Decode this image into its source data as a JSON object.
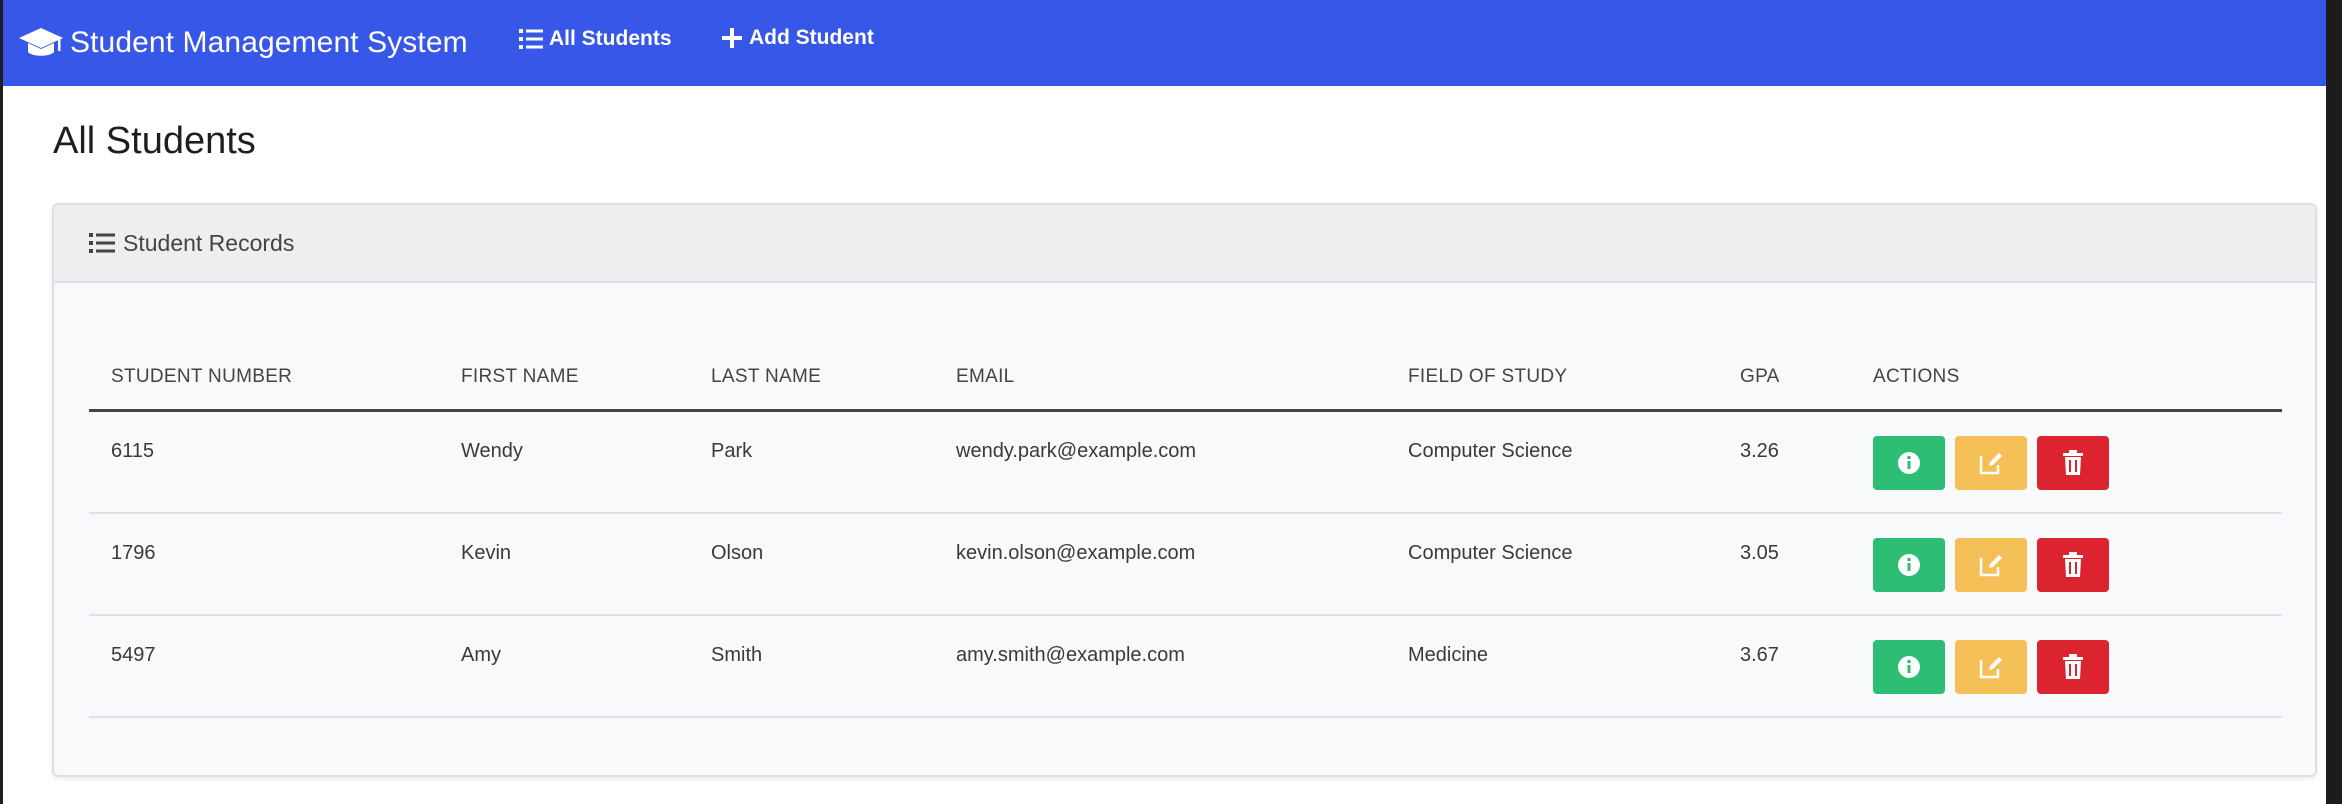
{
  "navbar": {
    "brand": "Student Management System",
    "links": [
      {
        "label": "All Students",
        "icon": "list-icon"
      },
      {
        "label": "Add Student",
        "icon": "plus-icon"
      }
    ]
  },
  "page": {
    "title": "All Students"
  },
  "card": {
    "header_title": "Student Records",
    "header_icon": "list-icon"
  },
  "table": {
    "columns": [
      "STUDENT NUMBER",
      "FIRST NAME",
      "LAST NAME",
      "EMAIL",
      "FIELD OF STUDY",
      "GPA",
      "ACTIONS"
    ],
    "rows": [
      {
        "student_number": "6115",
        "first_name": "Wendy",
        "last_name": "Park",
        "email": "wendy.park@example.com",
        "field_of_study": "Computer Science",
        "gpa": "3.26"
      },
      {
        "student_number": "1796",
        "first_name": "Kevin",
        "last_name": "Olson",
        "email": "kevin.olson@example.com",
        "field_of_study": "Computer Science",
        "gpa": "3.05"
      },
      {
        "student_number": "5497",
        "first_name": "Amy",
        "last_name": "Smith",
        "email": "amy.smith@example.com",
        "field_of_study": "Medicine",
        "gpa": "3.67"
      }
    ],
    "actions": [
      {
        "name": "view",
        "icon": "info-icon",
        "color": "#2ebd74"
      },
      {
        "name": "edit",
        "icon": "edit-icon",
        "color": "#f4bf56"
      },
      {
        "name": "delete",
        "icon": "trash-icon",
        "color": "#dc2430"
      }
    ]
  },
  "colors": {
    "navbar": "#3657e8",
    "card_header": "#eceef0",
    "card_body": "#f8f9fa"
  }
}
